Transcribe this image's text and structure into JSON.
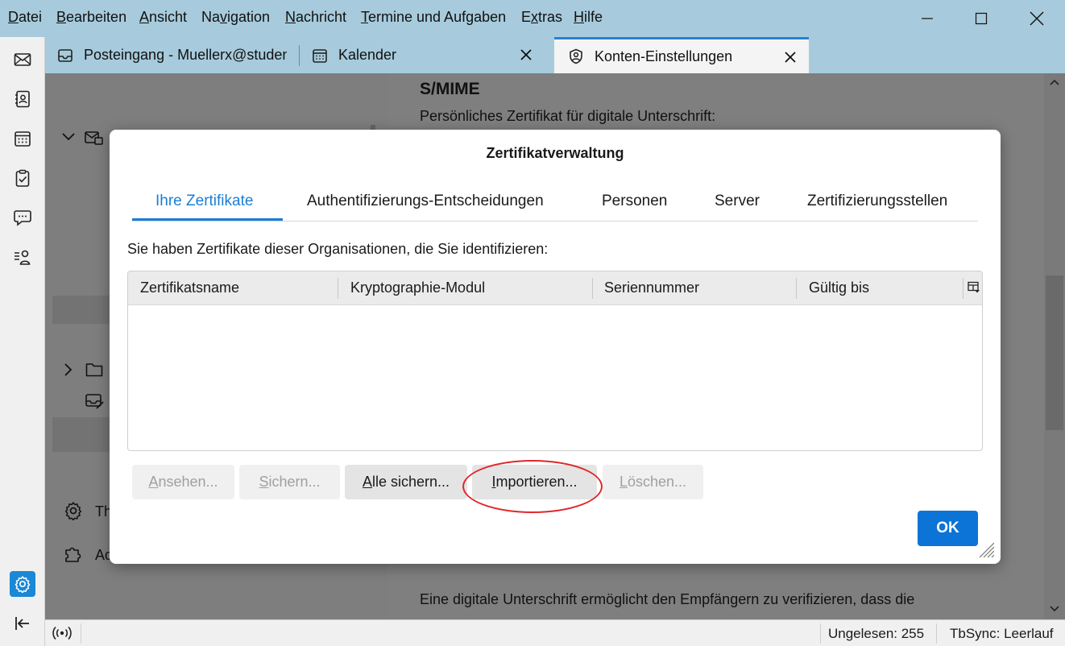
{
  "menubar": {
    "items": [
      {
        "pre": "",
        "accel": "D",
        "post": "atei"
      },
      {
        "pre": "",
        "accel": "B",
        "post": "earbeiten"
      },
      {
        "pre": "",
        "accel": "A",
        "post": "nsicht"
      },
      {
        "pre": "Na",
        "accel": "v",
        "post": "igation"
      },
      {
        "pre": "",
        "accel": "N",
        "post": "achricht"
      },
      {
        "pre": "",
        "accel": "T",
        "post": "ermine und Aufgaben"
      },
      {
        "pre": "E",
        "accel": "x",
        "post": "tras"
      },
      {
        "pre": "",
        "accel": "H",
        "post": "ilfe"
      }
    ]
  },
  "tabs": [
    {
      "label": "Posteingang - Muellerx@studen",
      "icon": "inbox-icon"
    },
    {
      "label": "Kalender",
      "icon": "calendar-icon"
    },
    {
      "label": "Konten-Einstellungen",
      "icon": "account-settings-icon"
    }
  ],
  "background": {
    "heading": "S/MIME",
    "cert_label": "Persönliches Zertifikat für digitale Unterschrift:",
    "signature_text": "Eine digitale Unterschrift ermöglicht den Empfängern zu verifizieren, dass die",
    "sidebar_item_1": "Th",
    "sidebar_item_2": "Ad"
  },
  "statusbar": {
    "unread": "Ungelesen: 255",
    "tbsync": "TbSync: Leerlauf"
  },
  "dialog": {
    "title": "Zertifikatverwaltung",
    "tabs": [
      "Ihre Zertifikate",
      "Authentifizierungs-Entscheidungen",
      "Personen",
      "Server",
      "Zertifizierungsstellen"
    ],
    "intro": "Sie haben Zertifikate dieser Organisationen, die Sie identifizieren:",
    "columns": [
      "Zertifikatsname",
      "Kryptographie-Modul",
      "Seriennummer",
      "Gültig bis"
    ],
    "buttons": {
      "view": {
        "pre": "",
        "accel": "A",
        "post": "nsehen..."
      },
      "backup": {
        "pre": "",
        "accel": "S",
        "post": "ichern..."
      },
      "backup_all": {
        "pre": "",
        "accel": "A",
        "post": "lle sichern..."
      },
      "import": {
        "pre": "",
        "accel": "I",
        "post": "mportieren..."
      },
      "delete": {
        "pre": "",
        "accel": "L",
        "post": "öschen..."
      },
      "ok": "OK"
    }
  },
  "colors": {
    "titlebar": "#a7cbdc",
    "accent": "#1a7ed6",
    "highlight": "#e0282a"
  }
}
